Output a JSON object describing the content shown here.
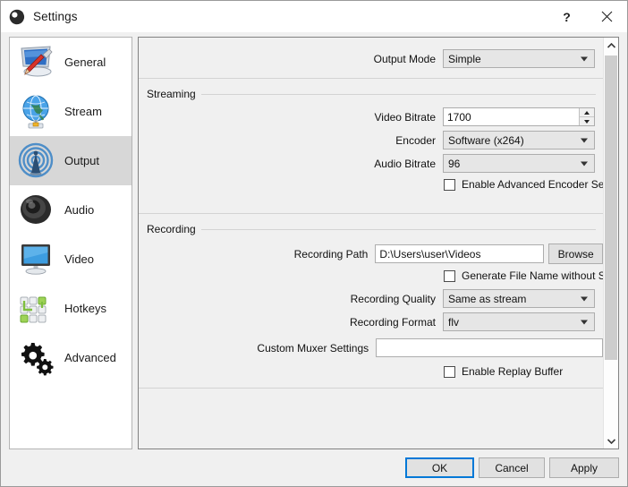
{
  "window": {
    "title": "Settings",
    "app_icon": "obs-logo-icon",
    "help_label": "?",
    "close_label": "✕"
  },
  "sidebar": {
    "items": [
      {
        "label": "General",
        "icon": "monitor-screwdriver-icon",
        "selected": false
      },
      {
        "label": "Stream",
        "icon": "globe-icon",
        "selected": false
      },
      {
        "label": "Output",
        "icon": "broadcast-tower-icon",
        "selected": true
      },
      {
        "label": "Audio",
        "icon": "speaker-icon",
        "selected": false
      },
      {
        "label": "Video",
        "icon": "monitor-icon",
        "selected": false
      },
      {
        "label": "Hotkeys",
        "icon": "keyboard-keys-icon",
        "selected": false
      },
      {
        "label": "Advanced",
        "icon": "gears-icon",
        "selected": false
      }
    ]
  },
  "output": {
    "output_mode": {
      "label": "Output Mode",
      "value": "Simple"
    },
    "streaming": {
      "group_title": "Streaming",
      "video_bitrate": {
        "label": "Video Bitrate",
        "value": "1700"
      },
      "encoder": {
        "label": "Encoder",
        "value": "Software (x264)"
      },
      "audio_bitrate": {
        "label": "Audio Bitrate",
        "value": "96"
      },
      "advanced_encoder": {
        "label": "Enable Advanced Encoder Settings",
        "checked": false
      }
    },
    "recording": {
      "group_title": "Recording",
      "recording_path": {
        "label": "Recording Path",
        "value": "D:\\Users\\user\\Videos"
      },
      "browse_label": "Browse",
      "no_space_filename": {
        "label": "Generate File Name without Space",
        "checked": false
      },
      "recording_quality": {
        "label": "Recording Quality",
        "value": "Same as stream"
      },
      "recording_format": {
        "label": "Recording Format",
        "value": "flv"
      },
      "custom_muxer": {
        "label": "Custom Muxer Settings",
        "value": "",
        "placeholder": ""
      },
      "replay_buffer": {
        "label": "Enable Replay Buffer",
        "checked": false
      }
    }
  },
  "footer": {
    "ok_label": "OK",
    "cancel_label": "Cancel",
    "apply_label": "Apply"
  },
  "colors": {
    "accent": "#0078d7",
    "selection": "#d7d7d7",
    "window_bg": "#f0f0f0"
  }
}
